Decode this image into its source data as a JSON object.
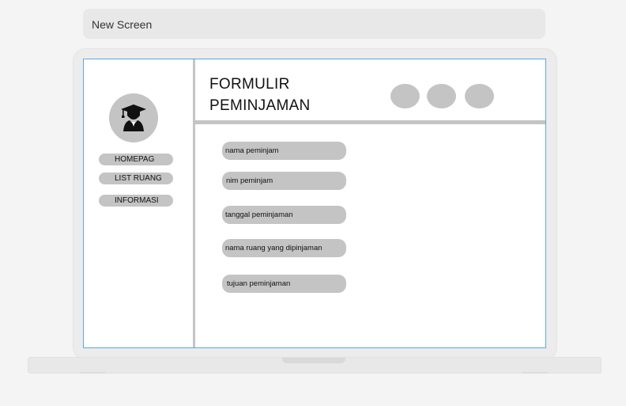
{
  "tab": {
    "title": "New Screen"
  },
  "sidebar": {
    "avatar_icon": "graduate-icon",
    "items": [
      {
        "label": "HOMEPAG"
      },
      {
        "label": "LIST RUANG"
      },
      {
        "label": "INFORMASI"
      }
    ]
  },
  "header": {
    "title_line1": "FORMULIR",
    "title_line2": "PEMINJAMAN"
  },
  "form": {
    "fields": [
      {
        "placeholder": "nama peminjam"
      },
      {
        "placeholder": "nim peminjam"
      },
      {
        "placeholder": "tanggal peminjaman"
      },
      {
        "placeholder": "nama ruang yang dipinjaman"
      },
      {
        "placeholder": "tujuan peminjaman"
      }
    ]
  },
  "colors": {
    "accent_border": "#5aa8e6",
    "placeholder_gray": "#c4c4c4"
  }
}
